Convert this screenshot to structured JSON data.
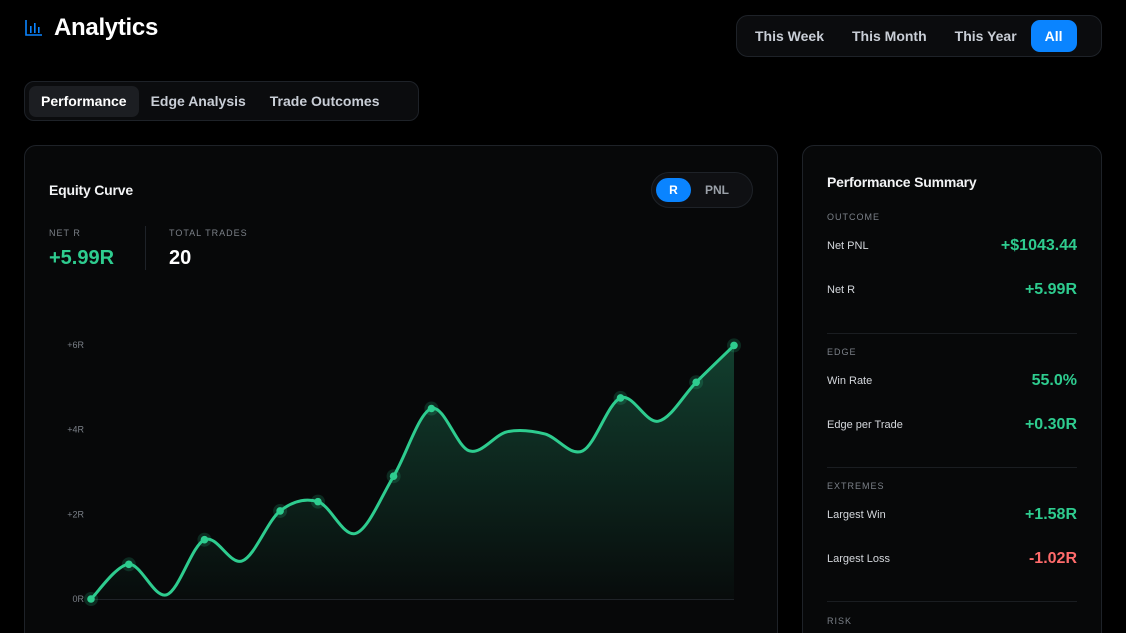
{
  "header": {
    "title": "Analytics",
    "logo_icon": "bar-chart-icon"
  },
  "range_filter": {
    "options": [
      "This Week",
      "This Month",
      "This Year",
      "All"
    ],
    "selected": "All"
  },
  "tabs": {
    "items": [
      "Performance",
      "Edge Analysis",
      "Trade Outcomes"
    ],
    "selected": "Performance"
  },
  "equity": {
    "title": "Equity Curve",
    "unit_options": [
      "R",
      "PNL"
    ],
    "unit_selected": "R",
    "net_r_label": "NET R",
    "net_r_value": "+5.99R",
    "total_trades_label": "TOTAL TRADES",
    "total_trades_value": "20"
  },
  "chart_data": {
    "type": "line",
    "title": "Equity Curve",
    "y_ticks": [
      "+6R",
      "+4R",
      "+2R",
      "0R"
    ],
    "ylim": [
      0,
      6
    ],
    "x": [
      0,
      1,
      2,
      3,
      4,
      5,
      6,
      7,
      8,
      9,
      10,
      11,
      12,
      13,
      14,
      15,
      16,
      17
    ],
    "values": [
      0.0,
      0.82,
      0.1,
      1.4,
      0.9,
      2.08,
      2.3,
      1.55,
      2.9,
      4.5,
      3.5,
      3.95,
      3.9,
      3.5,
      4.75,
      4.2,
      5.12,
      5.99
    ],
    "markers": [
      0,
      1,
      3,
      5,
      6,
      8,
      9,
      14,
      16,
      17
    ],
    "color": "#2ecc8f",
    "area_fill": true,
    "grid": false
  },
  "summary": {
    "title": "Performance Summary",
    "sections": {
      "outcome": {
        "label": "OUTCOME",
        "net_pnl_label": "Net PNL",
        "net_pnl_value": "+$1043.44",
        "net_r_label": "Net R",
        "net_r_value": "+5.99R"
      },
      "edge": {
        "label": "EDGE",
        "win_rate_label": "Win Rate",
        "win_rate_value": "55.0%",
        "edge_label": "Edge per Trade",
        "edge_value": "+0.30R"
      },
      "extremes": {
        "label": "EXTREMES",
        "largest_win_label": "Largest Win",
        "largest_win_value": "+1.58R",
        "largest_loss_label": "Largest Loss",
        "largest_loss_value": "-1.02R"
      },
      "risk": {
        "label": "RISK"
      }
    }
  },
  "colors": {
    "accent": "#0a84ff",
    "positive": "#2ecc8f",
    "negative": "#ff6b6b",
    "background": "#000000"
  }
}
